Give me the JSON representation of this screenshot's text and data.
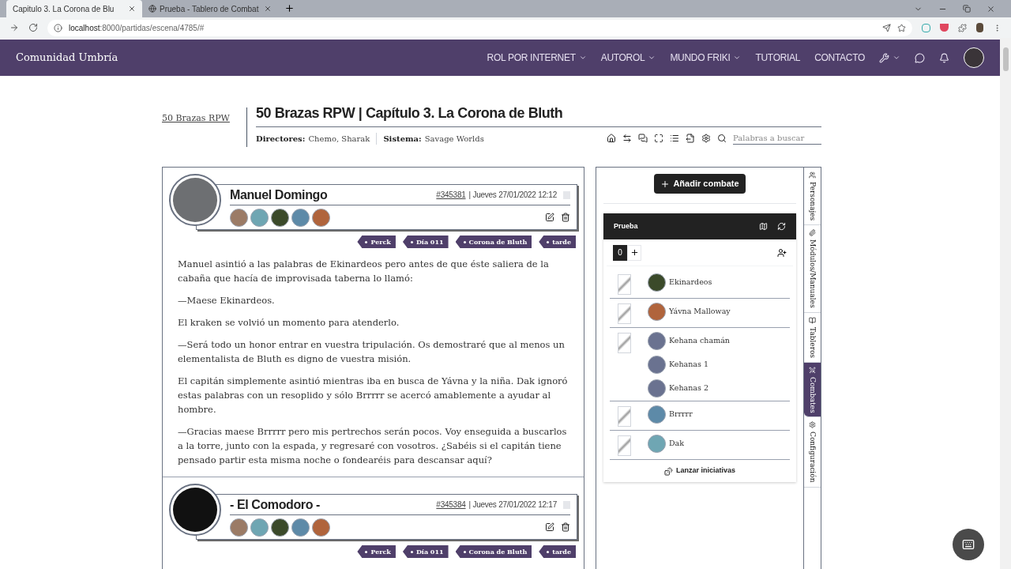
{
  "browser": {
    "tabs": [
      {
        "title": "Capitulo 3. La Corona de Blu",
        "selected": true
      },
      {
        "title": "Prueba - Tablero de Combat",
        "selected": false
      }
    ],
    "url_host": "localhost",
    "url_path": ":8000/partidas/escena/4785/#"
  },
  "nav": {
    "brand": "Comunidad Umbría",
    "items": [
      {
        "label": "ROL POR INTERNET",
        "dropdown": true
      },
      {
        "label": "AUTOROL",
        "dropdown": true
      },
      {
        "label": "MUNDO FRIKI",
        "dropdown": true
      },
      {
        "label": "TUTORIAL",
        "dropdown": false
      },
      {
        "label": "CONTACTO",
        "dropdown": false
      }
    ]
  },
  "header": {
    "logo_alt": "50 Brazas RPW",
    "title": "50 Brazas RPW | Capítulo 3. La Corona de Bluth",
    "directors_label": "Directores:",
    "directors": "Chemo, Sharak",
    "system_label": "Sistema:",
    "system": "Savage Worlds",
    "search": {
      "placeholder": "Palabras a buscar"
    }
  },
  "posts": [
    {
      "author": "Manuel Domingo",
      "ref": "#345381",
      "date": "| Jueves 27/01/2022 12:12",
      "tags": [
        "Perck",
        "Día 011",
        "Corona de Bluth",
        "tarde"
      ],
      "paragraphs": [
        "Manuel asintió a las palabras de Ekinardeos pero antes de que éste saliera de la cabaña que hacía de improvisada taberna lo llamó:",
        "—Maese Ekinardeos.",
        "El kraken se volvió un momento para atenderlo.",
        "—Será todo un honor entrar en vuestra tripulación. Os demostraré que al menos un elementalista de Bluth es digno de vuestra misión.",
        "El capitán simplemente asintió mientras iba en busca de Yávna y la niña. Dak ignoró estas palabras con un resoplido y sólo Brrrrr se acercó amablemente a ayudar al hombre.",
        "—Gracias maese Brrrrr pero mis pertrechos serán pocos. Voy enseguida a buscarlos a la torre, junto con la espada, y regresaré con vosotros. ¿Sabéis si el capitán tiene pensado partir esta misma noche o fondearéis para descansar aquí?"
      ]
    },
    {
      "author": "- El Comodoro -",
      "ref": "#345384",
      "date": "| Jueves 27/01/2022 12:17",
      "tags": [
        "Perck",
        "Día 011",
        "Corona de Bluth",
        "tarde"
      ]
    }
  ],
  "combat": {
    "add_button": "Añadir combate",
    "title": "Prueba",
    "round": "0",
    "groups": [
      {
        "members": [
          "Ekinardeos"
        ]
      },
      {
        "members": [
          "Yávna Malloway"
        ]
      },
      {
        "members": [
          "Kehana chamán",
          "Kehanas 1",
          "Kehanas 2"
        ]
      },
      {
        "members": [
          "Brrrrr"
        ]
      },
      {
        "members": [
          "Dak"
        ]
      }
    ],
    "launch": "Lanzar iniciativas"
  },
  "side_tabs": [
    {
      "label": "Personajes",
      "selected": false
    },
    {
      "label": "Módulos/Manuales",
      "selected": false
    },
    {
      "label": "Tableros",
      "selected": false
    },
    {
      "label": "Combates",
      "selected": true
    },
    {
      "label": "Configuración",
      "selected": false
    }
  ]
}
